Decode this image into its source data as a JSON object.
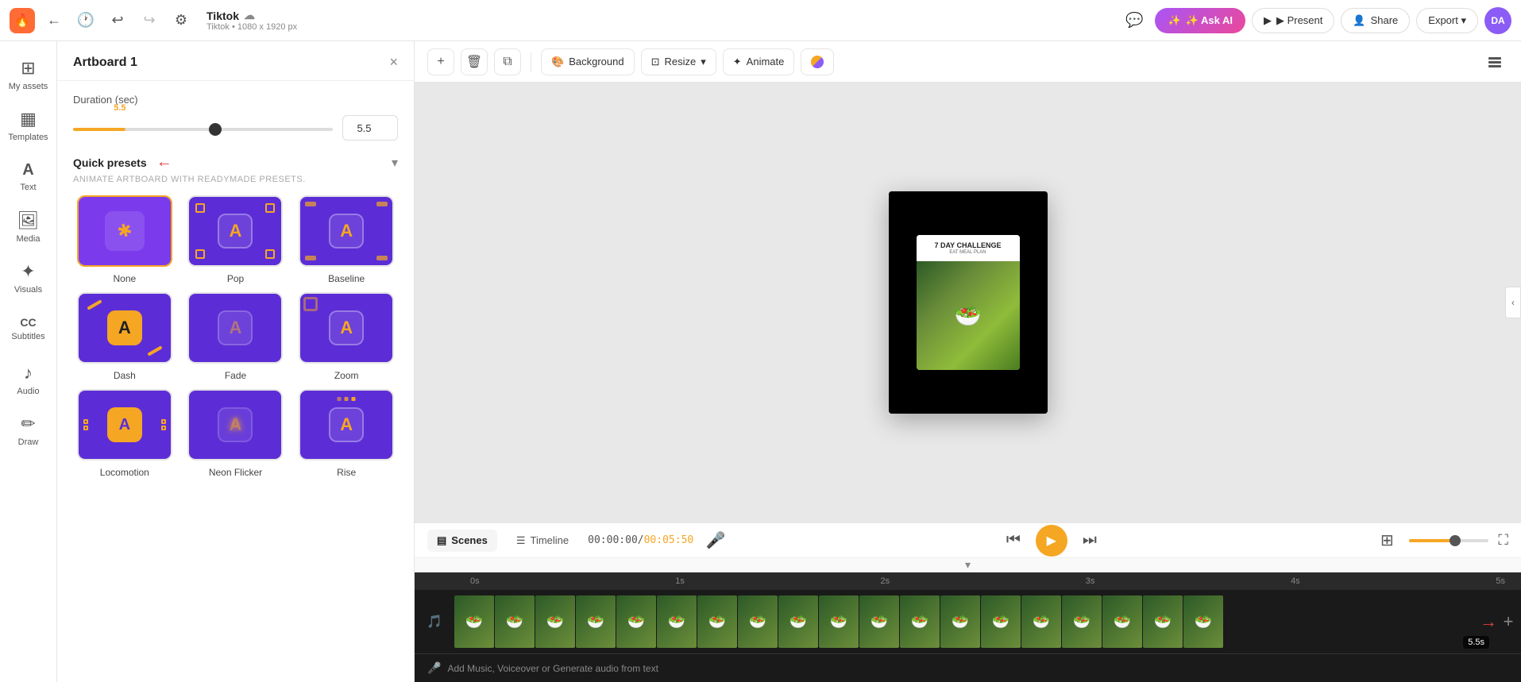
{
  "app": {
    "logo": "🔥",
    "title": "Tiktok",
    "cloud_icon": "☁",
    "subtitle": "Tiktok • 1080 x 1920 px"
  },
  "topbar": {
    "back_label": "←",
    "history_label": "🕐",
    "undo_label": "↩",
    "redo_label": "↪",
    "settings_label": "⚙",
    "comment_label": "💬",
    "ask_ai_label": "✨ Ask AI",
    "present_label": "▶ Present",
    "share_label": "👤 Share",
    "export_label": "Export ▾",
    "avatar_label": "DA"
  },
  "sidebar": {
    "items": [
      {
        "id": "my-assets",
        "label": "My assets",
        "icon": "⊞"
      },
      {
        "id": "templates",
        "label": "Templates",
        "icon": "▦"
      },
      {
        "id": "text",
        "label": "Text",
        "icon": "A"
      },
      {
        "id": "media",
        "label": "Media",
        "icon": "🖼"
      },
      {
        "id": "visuals",
        "label": "Visuals",
        "icon": "✦"
      },
      {
        "id": "subtitles",
        "label": "Subtitles",
        "icon": "CC"
      },
      {
        "id": "audio",
        "label": "Audio",
        "icon": "♪"
      },
      {
        "id": "draw",
        "label": "Draw",
        "icon": "✏"
      }
    ]
  },
  "panel": {
    "title": "Artboard 1",
    "close_label": "×",
    "duration_label": "Duration (sec)",
    "slider_min": 0,
    "slider_max": 10,
    "slider_value": 5.5,
    "slider_badge": "5.5",
    "duration_input_value": "5.5",
    "quick_presets_title": "Quick presets",
    "quick_presets_sub": "Animate artboard with readymade presets.",
    "presets": [
      {
        "id": "none",
        "label": "None",
        "active": true
      },
      {
        "id": "pop",
        "label": "Pop",
        "active": false
      },
      {
        "id": "baseline",
        "label": "Baseline",
        "active": false
      },
      {
        "id": "dash",
        "label": "Dash",
        "active": false
      },
      {
        "id": "fade",
        "label": "Fade",
        "active": false
      },
      {
        "id": "zoom",
        "label": "Zoom",
        "active": false
      },
      {
        "id": "locomotion",
        "label": "Locomotion",
        "active": false
      },
      {
        "id": "neon-flicker",
        "label": "Neon Flicker",
        "active": false
      },
      {
        "id": "rise",
        "label": "Rise",
        "active": false
      }
    ]
  },
  "canvas_toolbar": {
    "add_label": "+",
    "delete_label": "🗑",
    "duplicate_label": "⧉",
    "background_label": "Background",
    "resize_label": "Resize",
    "animate_label": "Animate",
    "layers_label": "⊞"
  },
  "canvas": {
    "design_title": "7 DAY CHALLENGE",
    "design_sub": "EAT MEAL PLAN",
    "design_emoji": "🥗"
  },
  "timeline": {
    "scenes_label": "Scenes",
    "timeline_label": "Timeline",
    "time_current": "00:00:00",
    "time_total": "00:05:50",
    "rewind_label": "⏮",
    "fast_forward_label": "⏭",
    "play_label": "▶",
    "fullscreen_label": "⛶",
    "ruler_marks": [
      "0s",
      "1s",
      "2s",
      "3s",
      "4s",
      "5s"
    ],
    "frame_duration": "5.5s",
    "add_scene_label": "+",
    "audio_label": "Add Music, Voiceover or Generate audio from text"
  },
  "colors": {
    "accent": "#f5a623",
    "purple": "#7c4dff",
    "ai_btn_start": "#a855f7",
    "ai_btn_end": "#ec4899",
    "topbar_bg": "#ffffff",
    "panel_bg": "#ffffff",
    "canvas_bg": "#e8e8e8",
    "timeline_bg": "#1a1a1a"
  }
}
